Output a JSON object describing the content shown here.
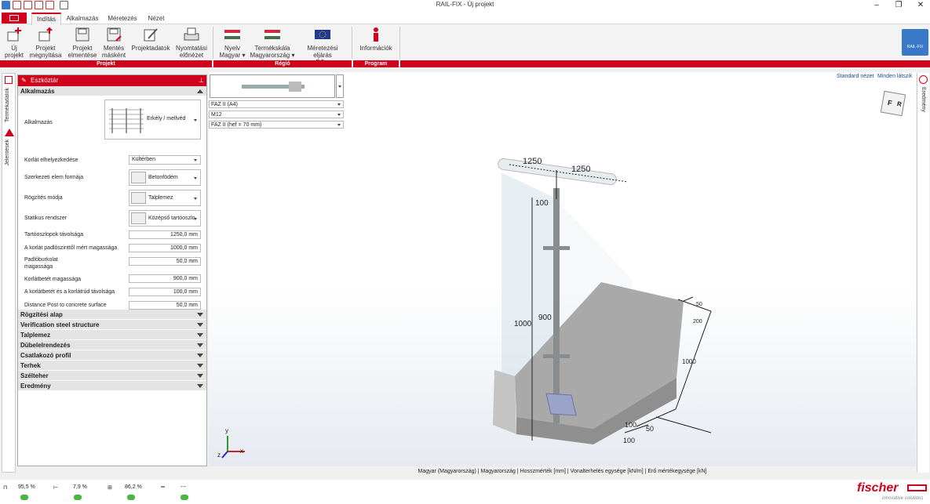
{
  "window": {
    "title": "RAIL-FIX - Új projekt"
  },
  "tabs": [
    "Indítás",
    "Alkalmazás",
    "Méretezés",
    "Nézet"
  ],
  "ribbon": {
    "buttons": [
      {
        "l1": "Új",
        "l2": "projekt"
      },
      {
        "l1": "Projekt",
        "l2": "megnyitása"
      },
      {
        "l1": "Projekt",
        "l2": "elmentése"
      },
      {
        "l1": "Mentés",
        "l2": "másként"
      },
      {
        "l1": "Projektadatok",
        "l2": ""
      },
      {
        "l1": "Nyomtatási",
        "l2": "előnézet"
      },
      {
        "l1": "Nyelv",
        "l2": "Magyar"
      },
      {
        "l1": "Termékskála",
        "l2": "Magyarország"
      },
      {
        "l1": "Méretezési eljárás",
        "l2": "EC"
      },
      {
        "l1": "Információk",
        "l2": ""
      }
    ],
    "groups": [
      "Projekt",
      "Régió",
      "Program"
    ],
    "logo_text": "RAIL-FIX"
  },
  "left_strip": {
    "tab1": "Termékadatok",
    "tab2": "Jelentések"
  },
  "toolbox": {
    "title": "Eszköztár",
    "section_open": "Alkalmazás",
    "application_label": "Alkalmazás",
    "application_value": "Erkély / mellvéd",
    "rows": [
      {
        "label": "Korlát elhelyezkedése",
        "value": "Kültérben"
      },
      {
        "label": "Szerkezeti elem formája",
        "value": "Betonfödém"
      },
      {
        "label": "Rögzítés módja",
        "value": "Talplemez"
      },
      {
        "label": "Statikus rendszer",
        "value": "Középső tartóoszlo"
      }
    ],
    "fields": [
      {
        "label": "Tartóoszlopok távolsága",
        "value": "1250,0 mm"
      },
      {
        "label": "A korlát padlószinttől mért magassága",
        "value": "1000,0 mm"
      },
      {
        "label": "Padlóburkolat",
        "label2": "magassága",
        "value": "50,0 mm"
      },
      {
        "label": "Korlátbetét magassága",
        "value": "900,0 mm"
      },
      {
        "label": "A korlátbetét és a korlátrúd távolsága",
        "value": "100,0 mm"
      },
      {
        "label": "Distance Post to concrete surface",
        "value": "50,0 mm"
      }
    ],
    "collapsed": [
      "Rögzítési alap",
      "Verification steel structure",
      "Talplemez",
      "Dübelelrendezés",
      "Csatlakozó profil",
      "Terhek",
      "Szélteher",
      "Eredmény"
    ]
  },
  "product": {
    "combos": [
      "FAZ II (A4)",
      "M12",
      "FAZ II (hef = 70 mm)"
    ]
  },
  "view": {
    "links": [
      "Standard nézet",
      "Minden látszik"
    ],
    "cube_letters": [
      "F",
      "R"
    ],
    "dims": {
      "d1250a": "1250",
      "d1250b": "1250",
      "d100a": "100",
      "d1000a": "1000",
      "d900": "900",
      "d50a": "50",
      "d200": "200",
      "d1000b": "1000",
      "d100b": "100",
      "d50b": "50",
      "d100c": "100"
    },
    "axes": {
      "x": "x",
      "y": "y",
      "z": "z"
    }
  },
  "right_strip": {
    "tab": "Eredmény"
  },
  "statusbar": "Magyar (Magyarország) | Magyarország | Hosszmérték [mm] | Vonalterhelés egysége [kN/m] | Erő mértékegysége [kN]",
  "footer": {
    "stats": [
      "95,5 %",
      "7,9 %",
      "86,2 %",
      "---"
    ],
    "brand": "fischer",
    "tagline": "innovative solutions"
  },
  "colors": {
    "accent": "#d0021b",
    "ok": "#4bb543"
  }
}
